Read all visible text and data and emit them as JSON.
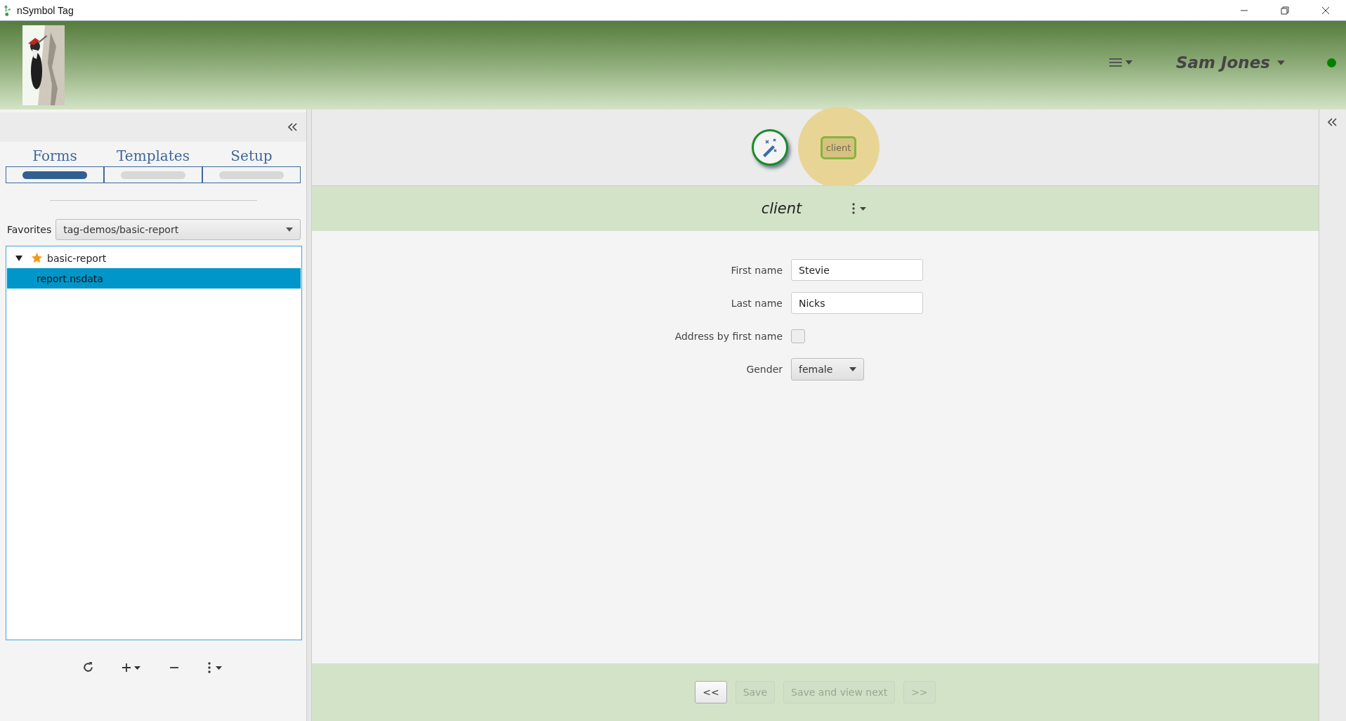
{
  "window": {
    "title": "nSymbol Tag"
  },
  "header": {
    "user": "Sam Jones",
    "status": {
      "color": "#008000"
    }
  },
  "sidebar": {
    "tabs": [
      {
        "label": "Forms",
        "selected": true
      },
      {
        "label": "Templates",
        "selected": false
      },
      {
        "label": "Setup",
        "selected": false
      }
    ],
    "favorites": {
      "label": "Favorites",
      "value": "tag-demos/basic-report"
    },
    "tree": [
      {
        "label": "basic-report",
        "starred": true,
        "expanded": true,
        "selected": false,
        "children": [
          {
            "label": "report.nsdata",
            "selected": true
          }
        ]
      }
    ]
  },
  "toolbar": {
    "chip": {
      "label": "client",
      "highlighted": true
    }
  },
  "form": {
    "title": "client",
    "fields": [
      {
        "kind": "text",
        "label": "First name",
        "value": "Stevie"
      },
      {
        "kind": "text",
        "label": "Last name",
        "value": "Nicks"
      },
      {
        "kind": "checkbox",
        "label": "Address by first name",
        "checked": false
      },
      {
        "kind": "select",
        "label": "Gender",
        "value": "female"
      }
    ]
  },
  "footer": {
    "buttons": [
      {
        "label": "<<",
        "disabled": false
      },
      {
        "label": "Save",
        "disabled": true
      },
      {
        "label": "Save and view next",
        "disabled": true
      },
      {
        "label": ">>",
        "disabled": true
      }
    ]
  }
}
